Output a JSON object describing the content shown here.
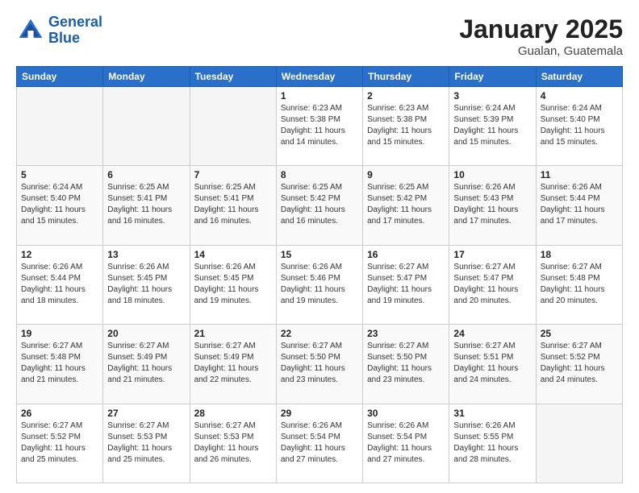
{
  "header": {
    "logo_line1": "General",
    "logo_line2": "Blue",
    "month": "January 2025",
    "location": "Gualan, Guatemala"
  },
  "weekdays": [
    "Sunday",
    "Monday",
    "Tuesday",
    "Wednesday",
    "Thursday",
    "Friday",
    "Saturday"
  ],
  "weeks": [
    [
      {
        "num": "",
        "info": ""
      },
      {
        "num": "",
        "info": ""
      },
      {
        "num": "",
        "info": ""
      },
      {
        "num": "1",
        "info": "Sunrise: 6:23 AM\nSunset: 5:38 PM\nDaylight: 11 hours\nand 14 minutes."
      },
      {
        "num": "2",
        "info": "Sunrise: 6:23 AM\nSunset: 5:38 PM\nDaylight: 11 hours\nand 15 minutes."
      },
      {
        "num": "3",
        "info": "Sunrise: 6:24 AM\nSunset: 5:39 PM\nDaylight: 11 hours\nand 15 minutes."
      },
      {
        "num": "4",
        "info": "Sunrise: 6:24 AM\nSunset: 5:40 PM\nDaylight: 11 hours\nand 15 minutes."
      }
    ],
    [
      {
        "num": "5",
        "info": "Sunrise: 6:24 AM\nSunset: 5:40 PM\nDaylight: 11 hours\nand 15 minutes."
      },
      {
        "num": "6",
        "info": "Sunrise: 6:25 AM\nSunset: 5:41 PM\nDaylight: 11 hours\nand 16 minutes."
      },
      {
        "num": "7",
        "info": "Sunrise: 6:25 AM\nSunset: 5:41 PM\nDaylight: 11 hours\nand 16 minutes."
      },
      {
        "num": "8",
        "info": "Sunrise: 6:25 AM\nSunset: 5:42 PM\nDaylight: 11 hours\nand 16 minutes."
      },
      {
        "num": "9",
        "info": "Sunrise: 6:25 AM\nSunset: 5:42 PM\nDaylight: 11 hours\nand 17 minutes."
      },
      {
        "num": "10",
        "info": "Sunrise: 6:26 AM\nSunset: 5:43 PM\nDaylight: 11 hours\nand 17 minutes."
      },
      {
        "num": "11",
        "info": "Sunrise: 6:26 AM\nSunset: 5:44 PM\nDaylight: 11 hours\nand 17 minutes."
      }
    ],
    [
      {
        "num": "12",
        "info": "Sunrise: 6:26 AM\nSunset: 5:44 PM\nDaylight: 11 hours\nand 18 minutes."
      },
      {
        "num": "13",
        "info": "Sunrise: 6:26 AM\nSunset: 5:45 PM\nDaylight: 11 hours\nand 18 minutes."
      },
      {
        "num": "14",
        "info": "Sunrise: 6:26 AM\nSunset: 5:45 PM\nDaylight: 11 hours\nand 19 minutes."
      },
      {
        "num": "15",
        "info": "Sunrise: 6:26 AM\nSunset: 5:46 PM\nDaylight: 11 hours\nand 19 minutes."
      },
      {
        "num": "16",
        "info": "Sunrise: 6:27 AM\nSunset: 5:47 PM\nDaylight: 11 hours\nand 19 minutes."
      },
      {
        "num": "17",
        "info": "Sunrise: 6:27 AM\nSunset: 5:47 PM\nDaylight: 11 hours\nand 20 minutes."
      },
      {
        "num": "18",
        "info": "Sunrise: 6:27 AM\nSunset: 5:48 PM\nDaylight: 11 hours\nand 20 minutes."
      }
    ],
    [
      {
        "num": "19",
        "info": "Sunrise: 6:27 AM\nSunset: 5:48 PM\nDaylight: 11 hours\nand 21 minutes."
      },
      {
        "num": "20",
        "info": "Sunrise: 6:27 AM\nSunset: 5:49 PM\nDaylight: 11 hours\nand 21 minutes."
      },
      {
        "num": "21",
        "info": "Sunrise: 6:27 AM\nSunset: 5:49 PM\nDaylight: 11 hours\nand 22 minutes."
      },
      {
        "num": "22",
        "info": "Sunrise: 6:27 AM\nSunset: 5:50 PM\nDaylight: 11 hours\nand 23 minutes."
      },
      {
        "num": "23",
        "info": "Sunrise: 6:27 AM\nSunset: 5:50 PM\nDaylight: 11 hours\nand 23 minutes."
      },
      {
        "num": "24",
        "info": "Sunrise: 6:27 AM\nSunset: 5:51 PM\nDaylight: 11 hours\nand 24 minutes."
      },
      {
        "num": "25",
        "info": "Sunrise: 6:27 AM\nSunset: 5:52 PM\nDaylight: 11 hours\nand 24 minutes."
      }
    ],
    [
      {
        "num": "26",
        "info": "Sunrise: 6:27 AM\nSunset: 5:52 PM\nDaylight: 11 hours\nand 25 minutes."
      },
      {
        "num": "27",
        "info": "Sunrise: 6:27 AM\nSunset: 5:53 PM\nDaylight: 11 hours\nand 25 minutes."
      },
      {
        "num": "28",
        "info": "Sunrise: 6:27 AM\nSunset: 5:53 PM\nDaylight: 11 hours\nand 26 minutes."
      },
      {
        "num": "29",
        "info": "Sunrise: 6:26 AM\nSunset: 5:54 PM\nDaylight: 11 hours\nand 27 minutes."
      },
      {
        "num": "30",
        "info": "Sunrise: 6:26 AM\nSunset: 5:54 PM\nDaylight: 11 hours\nand 27 minutes."
      },
      {
        "num": "31",
        "info": "Sunrise: 6:26 AM\nSunset: 5:55 PM\nDaylight: 11 hours\nand 28 minutes."
      },
      {
        "num": "",
        "info": ""
      }
    ]
  ]
}
